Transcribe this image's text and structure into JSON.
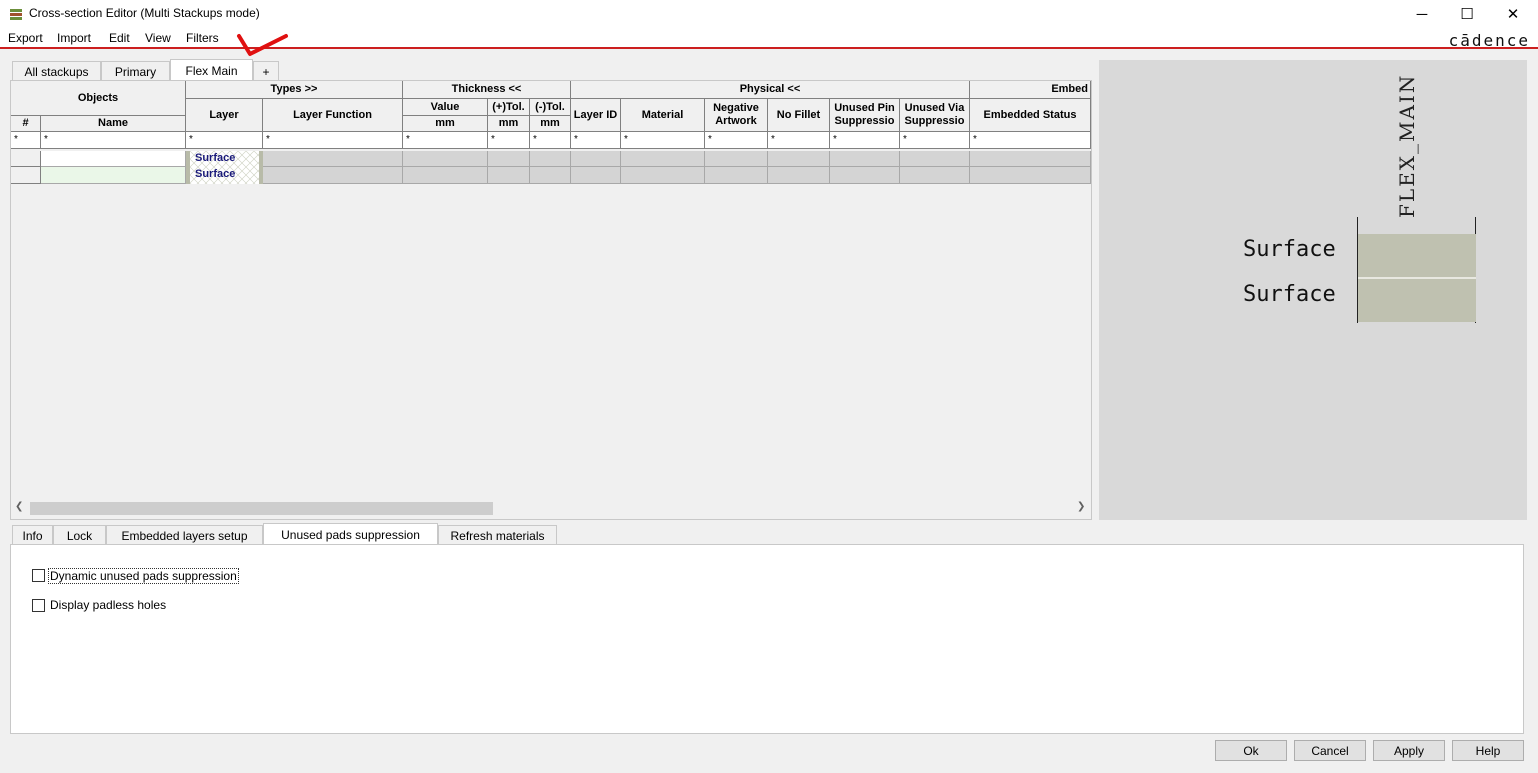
{
  "window": {
    "title": "Cross-section Editor (Multi Stackups mode)",
    "minimize_glyph": "─",
    "maximize_glyph": "☐",
    "close_glyph": "✕"
  },
  "menu": [
    "Export",
    "Import",
    "Edit",
    "View",
    "Filters"
  ],
  "brand": "cādence",
  "stackup_tabs": [
    "All stackups",
    "Primary",
    "Flex Main",
    "+"
  ],
  "grid": {
    "groups": {
      "objects": "Objects",
      "types": "Types >>",
      "thickness": "Thickness <<",
      "physical": "Physical <<",
      "embedded": "Embed"
    },
    "columns": {
      "num": "#",
      "name": "Name",
      "layer": "Layer",
      "layer_function": "Layer Function",
      "value": "Value",
      "plus_tol": "(+)Tol.",
      "minus_tol": "(-)Tol.",
      "unit_mm": "mm",
      "layer_id": "Layer ID",
      "material": "Material",
      "negative_artwork": "Negative Artwork",
      "no_fillet": "No Fillet",
      "unused_pin": "Unused Pin Suppressio",
      "unused_via": "Unused Via Suppressio",
      "embedded_status": "Embedded Status"
    },
    "filter": "*",
    "rows": [
      {
        "layer": "Surface"
      },
      {
        "layer": "Surface"
      }
    ]
  },
  "preview": {
    "stackup_name": "FLEX_MAIN",
    "layers": [
      "Surface",
      "Surface"
    ]
  },
  "bottom_tabs": [
    "Info",
    "Lock",
    "Embedded layers setup",
    "Unused pads suppression",
    "Refresh materials"
  ],
  "options": [
    {
      "label": "Dynamic unused pads suppression",
      "checked": false
    },
    {
      "label": "Display padless holes",
      "checked": false
    }
  ],
  "buttons": {
    "ok": "Ok",
    "cancel": "Cancel",
    "apply": "Apply",
    "help": "Help"
  },
  "colors": {
    "accent_red": "#cc1f1f",
    "layer_fill": "#bfc1b0",
    "surface_text": "#1a1a7a"
  }
}
